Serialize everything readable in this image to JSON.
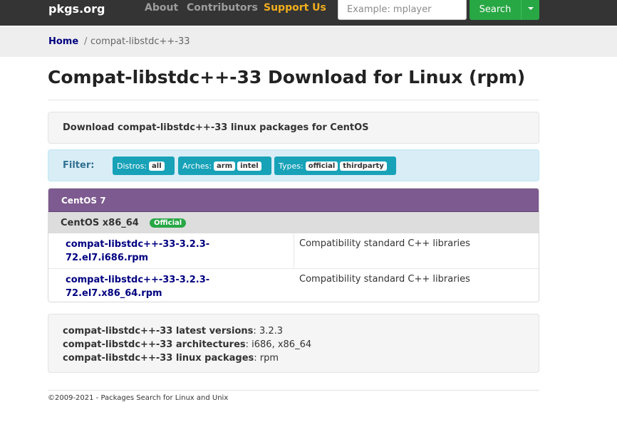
{
  "navbar": {
    "brand": "pkgs.org",
    "links": [
      "About",
      "Contributors",
      "Support Us"
    ],
    "search": {
      "placeholder": "Example: mplayer",
      "button_label": "Search"
    }
  },
  "breadcrumb": {
    "home": "Home",
    "separator": "/",
    "current": "compat-libstdc++-33"
  },
  "page_title": "Compat-libstdc++-33 Download for Linux (rpm)",
  "intro": "Download compat-libstdc++-33 linux packages for CentOS",
  "filter": {
    "label": "Filter:",
    "distros": {
      "label": "Distros:",
      "values": [
        "all"
      ]
    },
    "arches": {
      "label": "Arches:",
      "values": [
        "arm",
        "intel"
      ]
    },
    "types": {
      "label": "Types:",
      "values": [
        "official",
        "thirdparty"
      ]
    }
  },
  "panel": {
    "title": "CentOS 7",
    "subheading": "CentOS x86_64",
    "badge": "Official",
    "packages": [
      {
        "name_line1": "compat-libstdc++-33-3.2.3-",
        "name_line2": "72.el7.i686.rpm",
        "description": "Compatibility standard C++ libraries"
      },
      {
        "name_line1": "compat-libstdc++-33-3.2.3-",
        "name_line2": "72.el7.x86_64.rpm",
        "description": "Compatibility standard C++ libraries"
      }
    ]
  },
  "summary": [
    {
      "label": "compat-libstdc++-33 latest versions",
      "value": "3.2.3"
    },
    {
      "label": "compat-libstdc++-33 architectures",
      "value": "i686, x86_64"
    },
    {
      "label": "compat-libstdc++-33 linux packages",
      "value": "rpm"
    }
  ],
  "footer": "©2009-2021 - Packages Search for Linux and Unix",
  "colors": {
    "navbar": "#343434",
    "accent_green": "#28a745",
    "filter_chip": "#17a2b8",
    "panel_header": "#7d5a8f",
    "link": "#000080",
    "support_link": "#f0ad1e"
  }
}
